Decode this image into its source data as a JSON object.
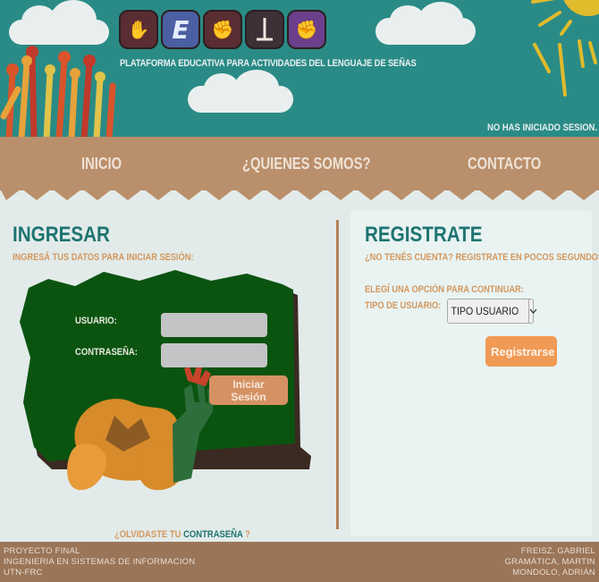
{
  "header": {
    "logo_icons": [
      "hand-sign-icon",
      "letter-e-icon",
      "fist-sign-icon",
      "letter-t-icon",
      "fist-sign-icon"
    ],
    "logo_letter": "E",
    "tagline": "PLATAFORMA EDUCATIVA PARA ACTIVIDADES DEL LENGUAJE DE SEÑAS",
    "session_status": "NO HAS INICIADO SESION."
  },
  "nav": {
    "items": [
      {
        "label": "INICIO"
      },
      {
        "label": "¿QUIENES SOMOS?"
      },
      {
        "label": "CONTACTO"
      }
    ]
  },
  "login": {
    "title": "INGRESAR",
    "subtitle": "INGRESÁ TUS DATOS PARA INICIAR SESIÓN:",
    "username_label": "USUARIO:",
    "username_value": "",
    "password_label": "CONTRASEÑA:",
    "password_value": "",
    "submit_label": "Iniciar Sesión",
    "forgot_prefix": "¿OLVIDASTE TU",
    "forgot_link": "CONTRASEÑA",
    "forgot_suffix": "?"
  },
  "register": {
    "title": "REGISTRATE",
    "subtitle": "¿NO TENÉS CUENTA? REGISTRATE EN POCOS SEGUNDOS.",
    "choose_option": "ELEGÍ UNA OPCIÓN PARA CONTINUAR:",
    "user_type_label": "TIPO DE USUARIO:",
    "user_type_selected": "TIPO USUARIO",
    "submit_label": "Registrarse"
  },
  "footer": {
    "left": [
      "PROYECTO FINAL",
      "INGENIERIA EN SISTEMAS DE INFORMACION",
      "UTN-FRC"
    ],
    "right": [
      "FREISZ, GABRIEL",
      "GRAMÁTICA, MARTIN",
      "MONDOLO, ADRIÁN"
    ]
  },
  "colors": {
    "header_bg": "#2a8b86",
    "nav_bg": "#ba8f6b",
    "accent_teal": "#1e7470",
    "accent_orange": "#d69163",
    "footer_bg": "#9b7558"
  }
}
